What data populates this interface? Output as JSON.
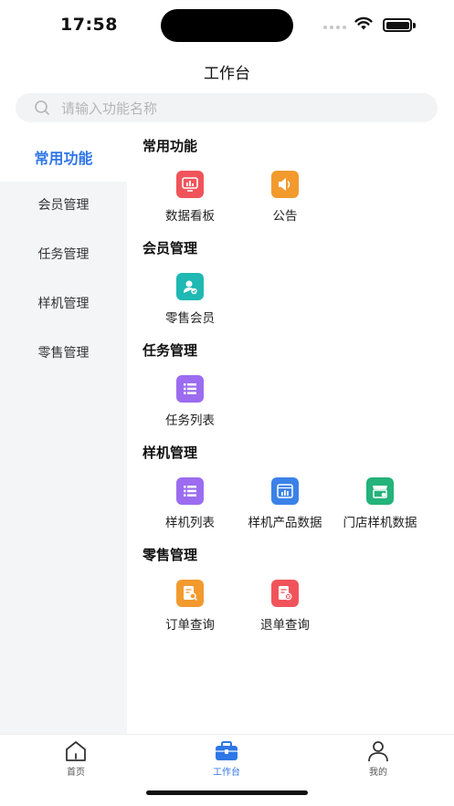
{
  "status_bar": {
    "time": "17:58"
  },
  "header": {
    "title": "工作台"
  },
  "search": {
    "placeholder": "请输入功能名称"
  },
  "sidebar": {
    "items": [
      {
        "label": "常用功能",
        "active": true
      },
      {
        "label": "会员管理"
      },
      {
        "label": "任务管理"
      },
      {
        "label": "样机管理"
      },
      {
        "label": "零售管理"
      }
    ]
  },
  "sections": [
    {
      "title": "常用功能",
      "items": [
        {
          "label": "数据看板",
          "icon": "dashboard-icon",
          "color": "#f0545a"
        },
        {
          "label": "公告",
          "icon": "speaker-icon",
          "color": "#f29a2e"
        }
      ]
    },
    {
      "title": "会员管理",
      "items": [
        {
          "label": "零售会员",
          "icon": "member-icon",
          "color": "#1fb8b2"
        }
      ]
    },
    {
      "title": "任务管理",
      "items": [
        {
          "label": "任务列表",
          "icon": "list-icon",
          "color": "#9b6cf0"
        }
      ]
    },
    {
      "title": "样机管理",
      "items": [
        {
          "label": "样机列表",
          "icon": "list-icon",
          "color": "#9b6cf0"
        },
        {
          "label": "样机产品数据",
          "icon": "chart-icon",
          "color": "#3b82e8"
        },
        {
          "label": "门店样机数据",
          "icon": "store-icon",
          "color": "#24b37a"
        }
      ]
    },
    {
      "title": "零售管理",
      "items": [
        {
          "label": "订单查询",
          "icon": "order-search-icon",
          "color": "#f29a2e"
        },
        {
          "label": "退单查询",
          "icon": "refund-icon",
          "color": "#f0545a"
        }
      ]
    }
  ],
  "tabbar": {
    "items": [
      {
        "label": "首页",
        "icon": "home-icon"
      },
      {
        "label": "工作台",
        "icon": "briefcase-icon",
        "active": true
      },
      {
        "label": "我的",
        "icon": "user-icon"
      }
    ]
  },
  "colors": {
    "accent": "#2f76e6",
    "sidebar_bg": "#f4f5f7",
    "search_bg": "#f2f3f5"
  }
}
